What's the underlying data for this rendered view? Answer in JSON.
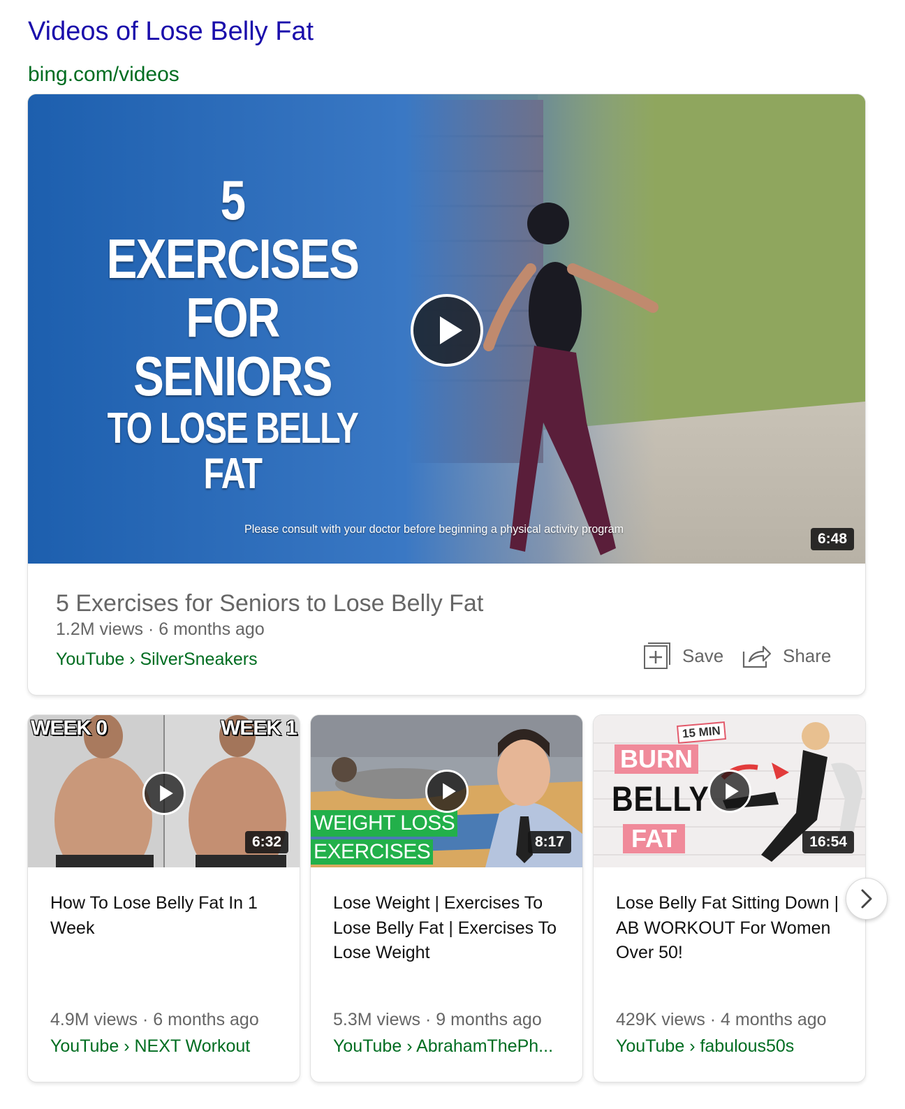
{
  "header": {
    "title": "Videos of Lose Belly Fat",
    "source": "bing.com/videos"
  },
  "featured": {
    "thumb_text_line1": "5 EXERCISES",
    "thumb_text_line2": "FOR SENIORS",
    "thumb_text_line3": "TO LOSE BELLY FAT",
    "thumb_caption": "Please consult with your doctor before beginning a physical activity program",
    "duration": "6:48",
    "title": "5 Exercises for Seniors to Lose Belly Fat",
    "meta": "1.2M views · 6 months ago",
    "source": "YouTube › SilverSneakers",
    "save_label": "Save",
    "share_label": "Share"
  },
  "videos": [
    {
      "thumb_text_left": "WEEK 0",
      "thumb_text_right": "WEEK 1",
      "duration": "6:32",
      "title": "How To Lose Belly Fat In 1 Week",
      "meta": "4.9M views · 6 months ago",
      "source": "YouTube › NEXT Workout"
    },
    {
      "thumb_text_line1": "WEIGHT LOSS",
      "thumb_text_line2": "EXERCISES",
      "duration": "8:17",
      "title": "Lose Weight | Exercises To Lose Belly Fat | Exercises To Lose Weight",
      "meta": "5.3M views · 9 months ago",
      "source": "YouTube › AbrahamThePh..."
    },
    {
      "thumb_badge": "15 MIN",
      "thumb_word1": "BURN",
      "thumb_word2": "BELLY",
      "thumb_word3": "FAT",
      "duration": "16:54",
      "title": "Lose Belly Fat Sitting Down | AB WORKOUT For Women Over 50!",
      "meta": "429K views · 4 months ago",
      "source": "YouTube › fabulous50s"
    }
  ],
  "icons": {
    "play": "play-icon",
    "save": "add-to-collection-icon",
    "share": "share-arrow-icon",
    "next": "chevron-right-icon"
  },
  "colors": {
    "title_link": "#1a0dab",
    "source_green": "#006d21",
    "meta_gray": "#666666"
  }
}
